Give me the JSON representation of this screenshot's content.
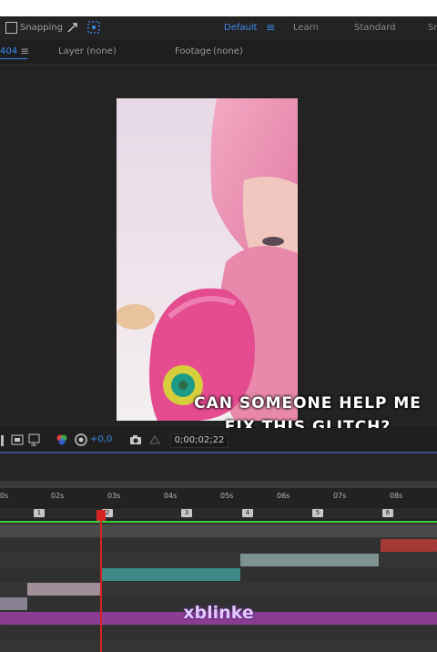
{
  "toolbar": {
    "snapping_label": "Snapping",
    "workspaces": [
      "Default",
      "Learn",
      "Standard",
      "Sm"
    ],
    "accent": "#3b8cf0"
  },
  "tabbar": {
    "comp_tab": "404",
    "layer_label": "Layer",
    "layer_value": "(none)",
    "footage_label": "Footage",
    "footage_value": "(none)"
  },
  "viewer": {
    "zoom_offset": "+0,0",
    "timecode": "0;00;02;22"
  },
  "timeline": {
    "ticks": [
      "0s",
      "02s",
      "03s",
      "04s",
      "05s",
      "06s",
      "07s",
      "08s"
    ],
    "markers": [
      "1",
      "2",
      "3",
      "4",
      "5",
      "6"
    ]
  },
  "caption": {
    "line1": "CAN SOMEONE HELP ME",
    "line2": "FIX THIS GLITCH?"
  },
  "watermark": "xblinke"
}
